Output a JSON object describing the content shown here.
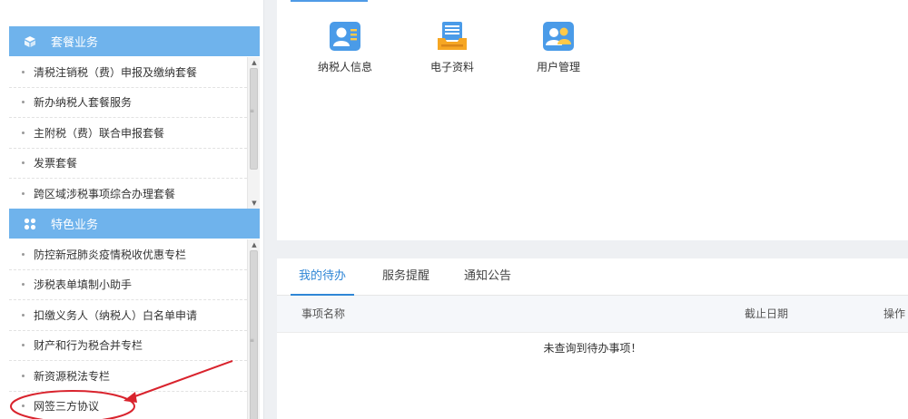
{
  "sidebar": {
    "sections": [
      {
        "title": "套餐业务",
        "icon": "cube-icon",
        "items": [
          "清税注销税（费）申报及缴纳套餐",
          "新办纳税人套餐服务",
          "主附税（费）联合申报套餐",
          "发票套餐",
          "跨区域涉税事项综合办理套餐"
        ]
      },
      {
        "title": "特色业务",
        "icon": "grid-icon",
        "items": [
          "防控新冠肺炎疫情税收优惠专栏",
          "涉税表单填制小助手",
          "扣缴义务人（纳税人）白名单申请",
          "财产和行为税合并专栏",
          "新资源税法专栏",
          "网签三方协议"
        ]
      }
    ]
  },
  "quick_links": [
    {
      "label": "纳税人信息",
      "icon": "taxpayer-card-icon"
    },
    {
      "label": "电子资料",
      "icon": "document-tray-icon"
    },
    {
      "label": "用户管理",
      "icon": "user-group-icon"
    }
  ],
  "tasks": {
    "tabs": [
      "我的待办",
      "服务提醒",
      "通知公告"
    ],
    "active_tab": "我的待办",
    "columns": [
      "事项名称",
      "截止日期",
      "操作"
    ],
    "empty_message": "未查询到待办事项！"
  },
  "colors": {
    "section_header": "#6fb3ec",
    "accent": "#2f86d6",
    "annotation": "#d9232d"
  }
}
